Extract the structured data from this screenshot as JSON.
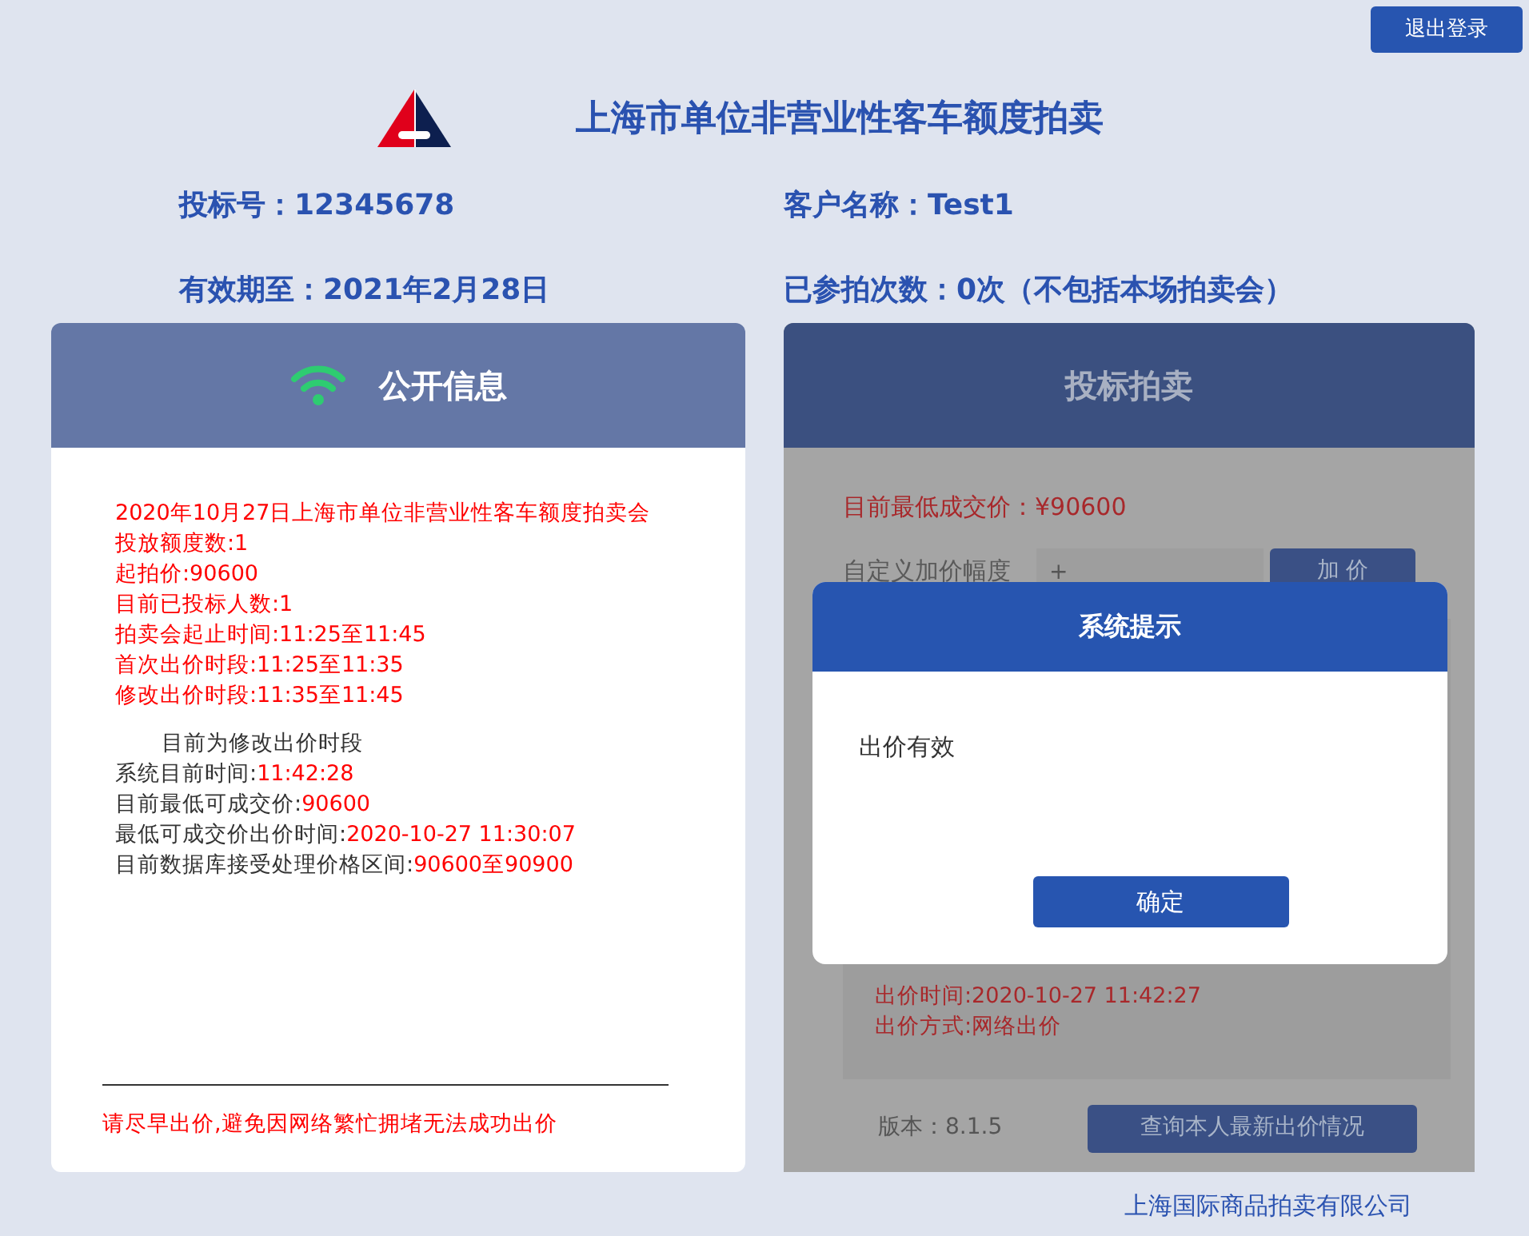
{
  "logout_button": "退出登录",
  "header": {
    "title": "上海市单位非营业性客车额度拍卖"
  },
  "bidder": {
    "fields": [
      "投标号：12345678",
      "客户名称：Test1",
      "有效期至：2021年2月28日",
      "已参拍次数：0次（不包括本场拍卖会）"
    ]
  },
  "public_info": {
    "title": "公开信息",
    "notices": [
      "2020年10月27日上海市单位非营业性客车额度拍卖会",
      "投放额度数:1",
      "起拍价:90600",
      "目前已投标人数:1",
      "拍卖会起止时间:11:25至11:45",
      "首次出价时段:11:25至11:35",
      "修改出价时段:11:35至11:45"
    ],
    "status": "目前为修改出价时段",
    "readings": [
      {
        "label": "系统目前时间:",
        "value": "11:42:28"
      },
      {
        "label": "目前最低可成交价:",
        "value": "90600"
      },
      {
        "label": "最低可成交价出价时间:",
        "value": "2020-10-27 11:30:07"
      },
      {
        "label": "目前数据库接受处理价格区间:",
        "value": "90600至90900"
      }
    ],
    "warning": "请尽早出价,避免因网络繁忙拥堵无法成功出价"
  },
  "bidding": {
    "title": "投标拍卖",
    "lowest_price": "目前最低成交价：¥90600",
    "custom_increment": {
      "label": "自定义加价幅度",
      "value": "+",
      "button": "加 价"
    },
    "bid_details": [
      "出价时间:2020-10-27 11:42:27",
      "出价方式:网络出价"
    ],
    "version": "版本：8.1.5",
    "query_button": "查询本人最新出价情况"
  },
  "dialog": {
    "title": "系统提示",
    "message": "出价有效",
    "button": "确定"
  },
  "footer": "上海国际商品拍卖有限公司"
}
